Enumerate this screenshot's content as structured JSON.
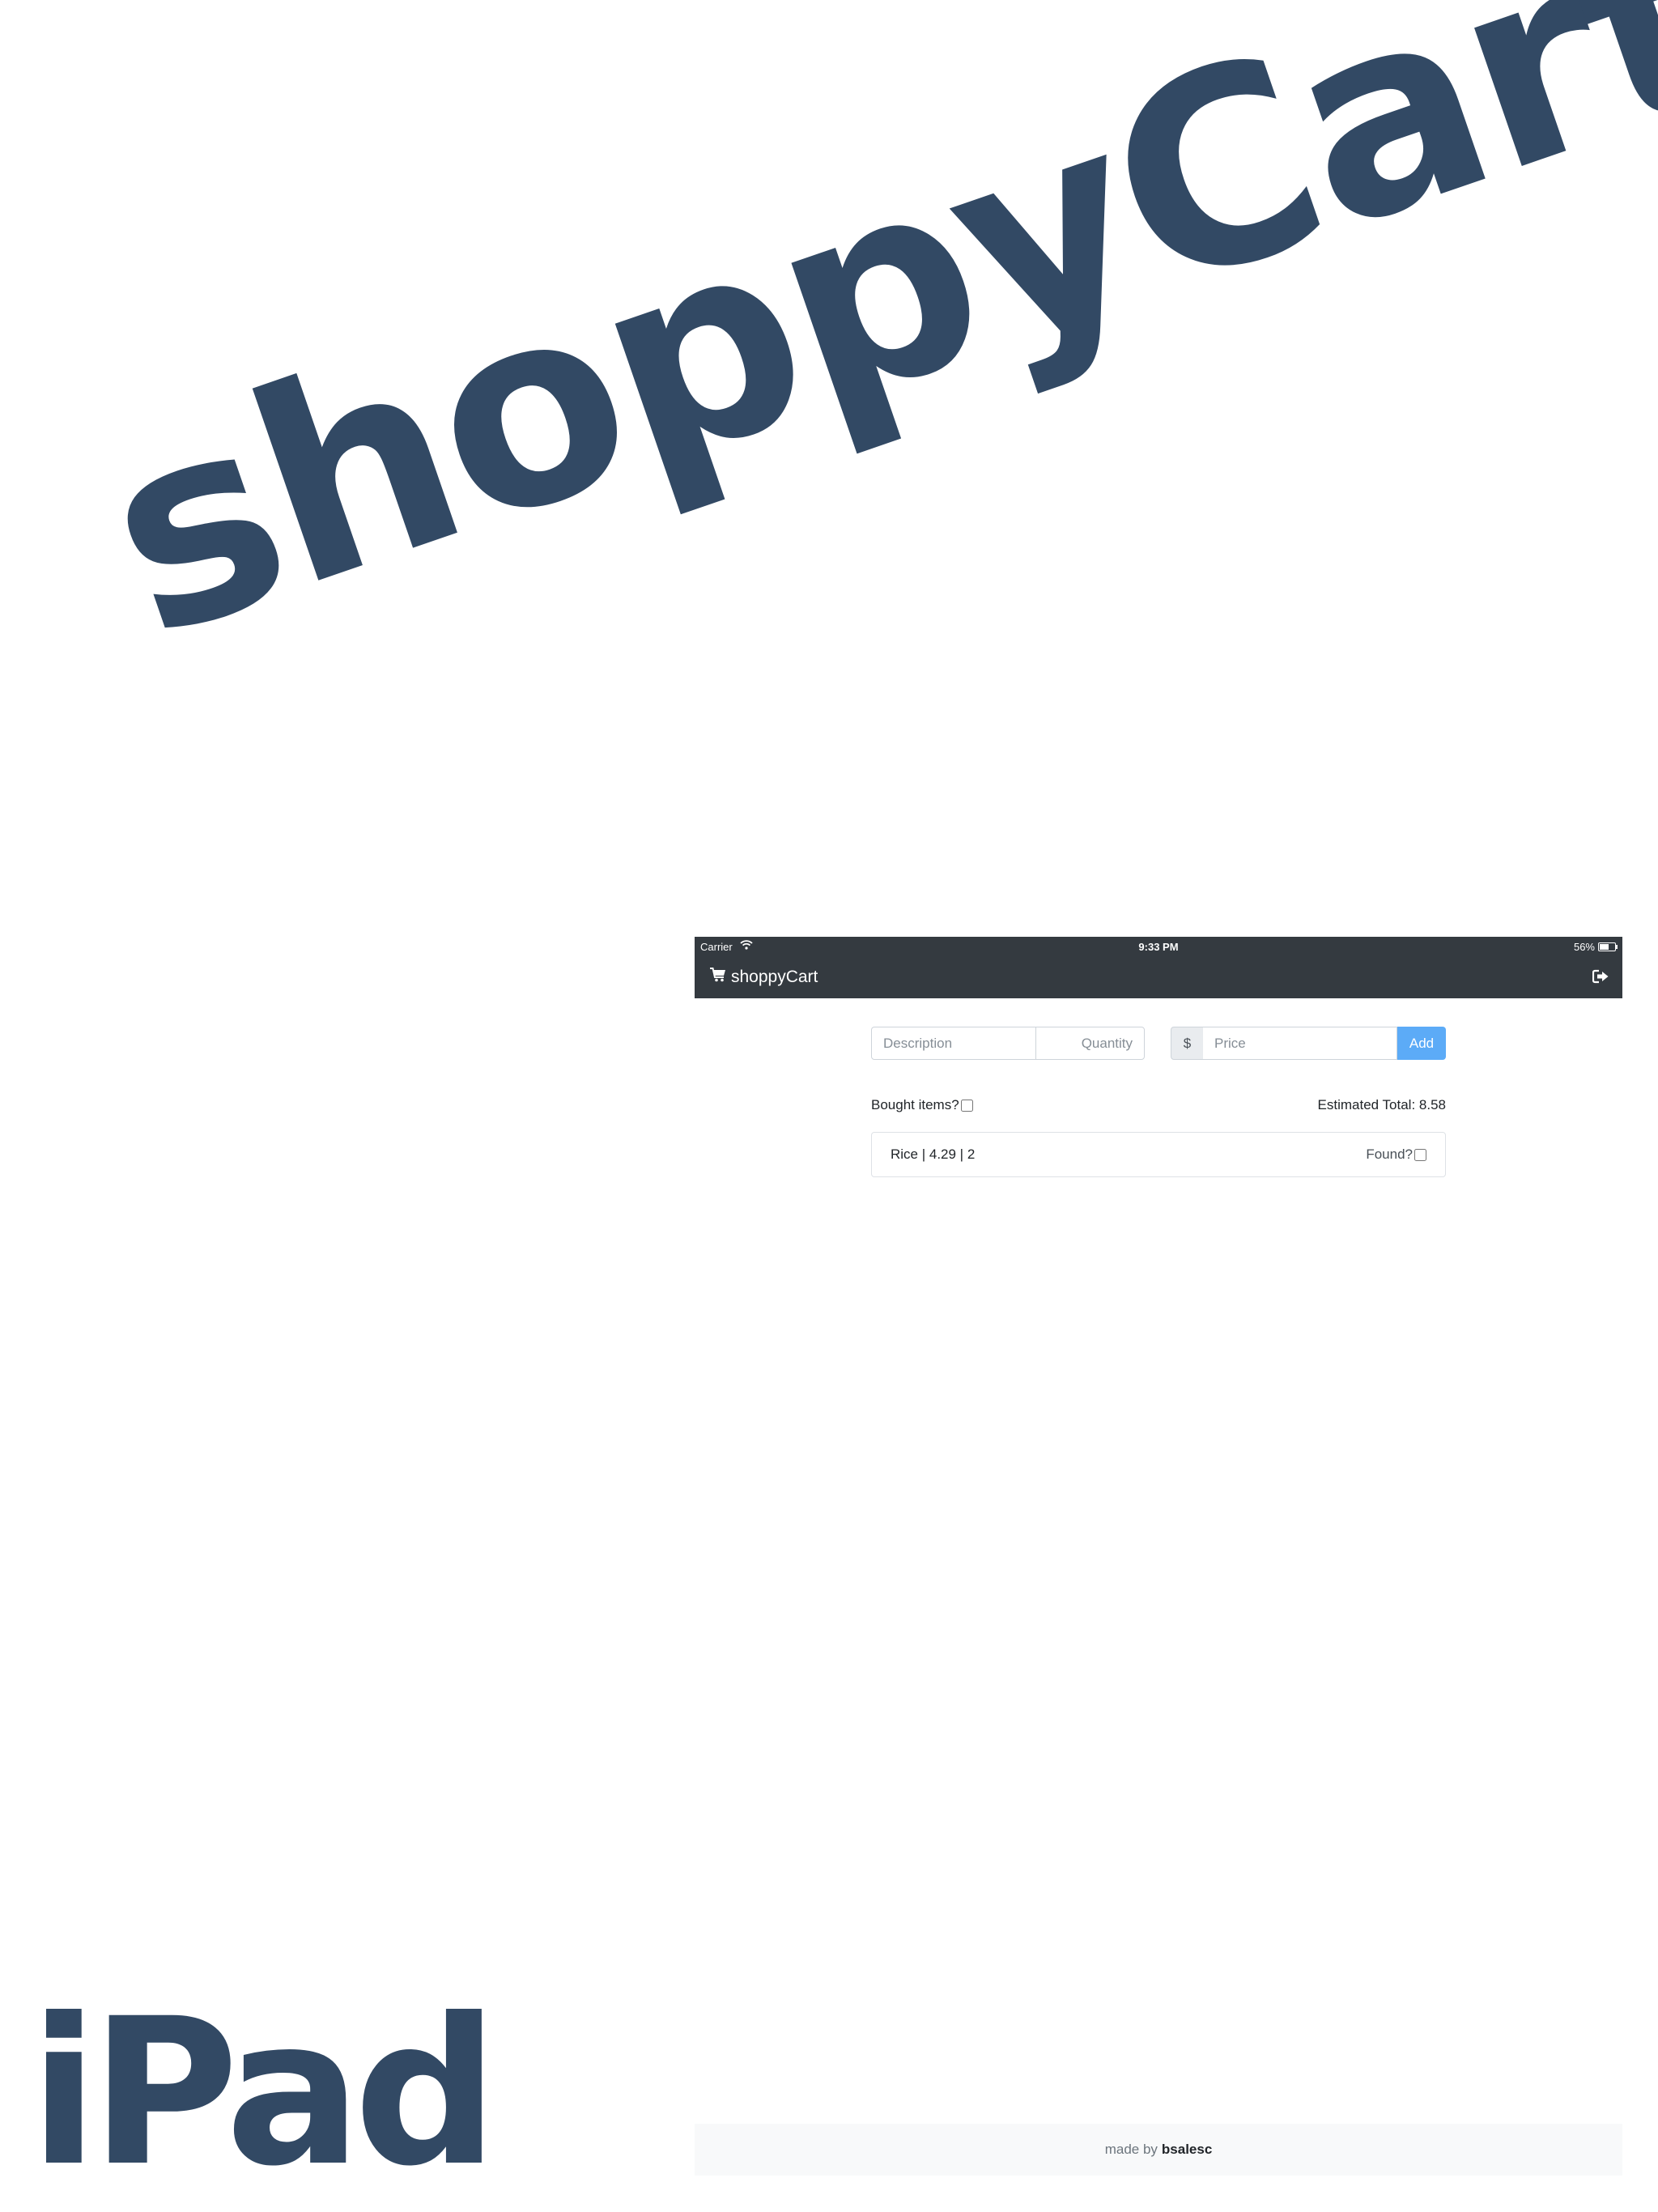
{
  "hero": {
    "title": "shoppyCart"
  },
  "device": {
    "label": "iPad"
  },
  "status_bar": {
    "carrier": "Carrier",
    "time": "9:33 PM",
    "battery": "56%"
  },
  "navbar": {
    "brand": "shoppyCart",
    "brand_icon": "shopping-cart-icon",
    "logout_icon": "sign-out-icon"
  },
  "form": {
    "description_placeholder": "Description",
    "description_value": "",
    "quantity_placeholder": "Quantity",
    "quantity_value": "",
    "currency": "$",
    "price_placeholder": "Price",
    "price_value": "",
    "add_label": "Add"
  },
  "summary": {
    "bought_label": "Bought items?",
    "bought_checked": false,
    "estimated_total": "Estimated Total: 8.58"
  },
  "items": [
    {
      "text": "Rice | 4.29 | 2",
      "found_label": "Found?",
      "found_checked": false
    }
  ],
  "footer": {
    "prefix": "made by",
    "author": "bsalesc"
  },
  "colors": {
    "brand_navy": "#324964",
    "navbar_bg": "#343a40",
    "add_button": "#5cabf7"
  }
}
